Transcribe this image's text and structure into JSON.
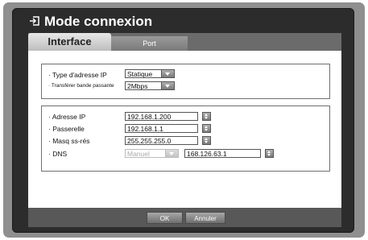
{
  "dialog": {
    "title": "Mode connexion"
  },
  "tabs": [
    {
      "label": "Interface",
      "active": true
    },
    {
      "label": "Port",
      "active": false
    }
  ],
  "transfer_settings": {
    "ip_type_label": "· Type d'adresse IP",
    "ip_type_value": "Statique",
    "bandwidth_label": "· Transférer bande passante",
    "bandwidth_value": "2Mbps"
  },
  "network_settings": {
    "ip_label": "· Adresse IP",
    "ip_value": "192.168.1.200",
    "gateway_label": "· Passerelle",
    "gateway_value": "192.168.1.1",
    "subnet_label": "· Masq ss-rés",
    "subnet_value": "255.255.255.0",
    "dns_label": "· DNS",
    "dns_mode_value": "Manuel",
    "dns_value": "168.126.63.1"
  },
  "buttons": {
    "ok": "OK",
    "cancel": "Annuler"
  },
  "colors": {
    "frame_bg": "#2c2c2c",
    "outer_bg": "#8f8f8f",
    "tab_active": "#d8d8d8",
    "button": "#8a8a8a"
  }
}
